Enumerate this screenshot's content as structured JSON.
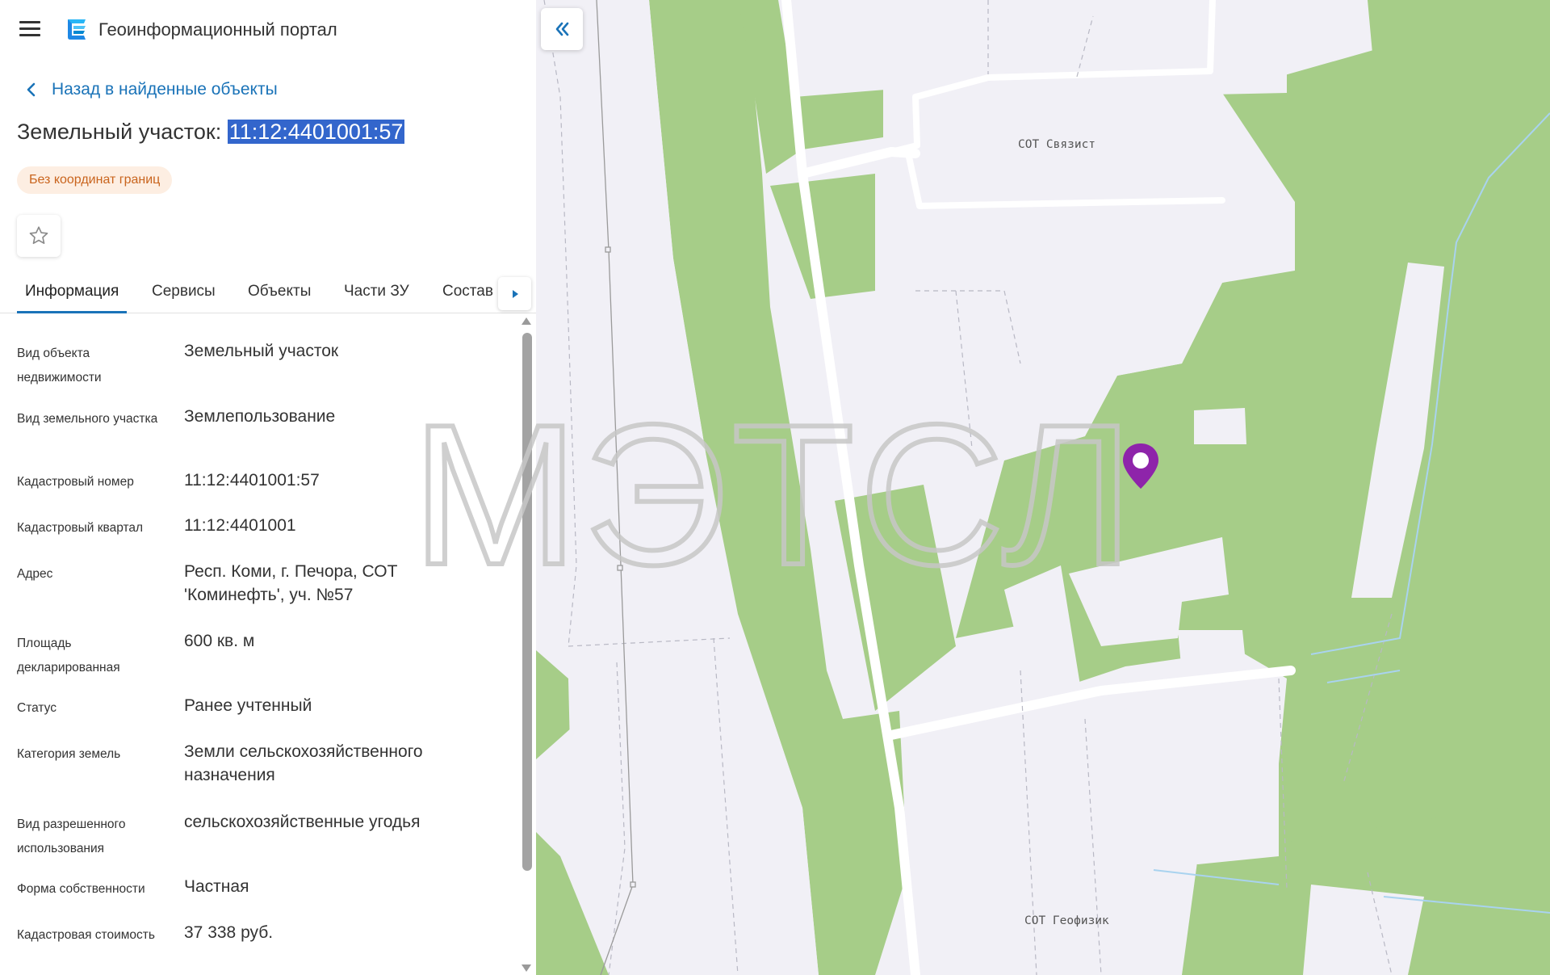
{
  "header": {
    "app_title": "Геоинформационный портал"
  },
  "navigation": {
    "back_label": "Назад в найденные объекты"
  },
  "object": {
    "title_prefix": "Земельный участок: ",
    "cadastral_number": "11:12:4401001:57",
    "badge": "Без координат границ"
  },
  "tabs": [
    {
      "label": "Информация",
      "active": true
    },
    {
      "label": "Сервисы",
      "active": false
    },
    {
      "label": "Объекты",
      "active": false
    },
    {
      "label": "Части ЗУ",
      "active": false
    },
    {
      "label": "Состав",
      "active": false
    }
  ],
  "properties": [
    {
      "label": "Вид объекта недвижимости",
      "value": "Земельный участок"
    },
    {
      "label": "Вид земельного участка",
      "value": "Землепользование"
    },
    {
      "label": "Кадастровый номер",
      "value": "11:12:4401001:57"
    },
    {
      "label": "Кадастровый квартал",
      "value": "11:12:4401001"
    },
    {
      "label": "Адрес",
      "value": "Респ. Коми, г. Печора, СОТ 'Коминефть', уч. №57"
    },
    {
      "label": "Площадь декларированная",
      "value": "600 кв. м"
    },
    {
      "label": "Статус",
      "value": "Ранее учтенный"
    },
    {
      "label": "Категория земель",
      "value": "Земли сельскохозяйственного назначения"
    },
    {
      "label": "Вид разрешенного использования",
      "value": "сельскохозяйственные угодья"
    },
    {
      "label": "Форма собственности",
      "value": "Частная"
    },
    {
      "label": "Кадастровая стоимость",
      "value": "37 338 руб."
    }
  ],
  "map": {
    "labels": {
      "svyazist": "СОТ Связист",
      "geofizik": "СОТ Геофизик"
    },
    "colors": {
      "vegetation": "#a6cd88",
      "background": "#f1f0f6",
      "marker": "#8e24aa",
      "accent": "#1a73b8"
    }
  },
  "watermark": {
    "text": "МЭТСЛ"
  },
  "icons": {
    "menu": "hamburger-menu-icon",
    "logo": "portal-logo-icon",
    "back": "chevron-left-icon",
    "favorite": "star-outline-icon",
    "tabs_scroll": "triangle-right-icon",
    "collapse": "double-chevron-left-icon",
    "marker": "map-pin-icon"
  }
}
